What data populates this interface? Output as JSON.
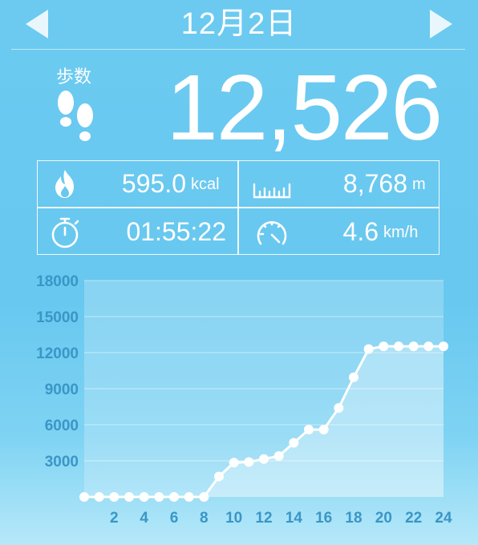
{
  "header": {
    "date": "12月2日",
    "prev_icon": "triangle-left",
    "next_icon": "triangle-right"
  },
  "steps": {
    "label": "歩数",
    "value": "12,526",
    "icon": "footprints"
  },
  "stats": {
    "calories": {
      "value": "595.0",
      "unit": "kcal",
      "icon": "flame"
    },
    "distance": {
      "value": "8,768",
      "unit": "m",
      "icon": "ruler"
    },
    "duration": {
      "value": "01:55:22",
      "unit": "",
      "icon": "stopwatch"
    },
    "speed": {
      "value": "4.6",
      "unit": "km/h",
      "icon": "speedometer"
    }
  },
  "colors": {
    "background": "#68c8ef",
    "tick_label": "#3a96c6",
    "line": "#ffffff"
  },
  "chart_data": {
    "type": "line",
    "x": [
      0,
      1,
      2,
      3,
      4,
      5,
      6,
      7,
      8,
      9,
      10,
      11,
      12,
      13,
      14,
      15,
      16,
      17,
      18,
      19,
      20,
      21,
      22,
      23,
      24
    ],
    "values": [
      0,
      0,
      0,
      0,
      0,
      0,
      0,
      0,
      0,
      1700,
      2850,
      2900,
      3150,
      3400,
      4500,
      5600,
      5600,
      7400,
      9950,
      12300,
      12526,
      12526,
      12526,
      12526,
      12526
    ],
    "y_ticks": [
      "3000",
      "6000",
      "9000",
      "12000",
      "15000",
      "18000"
    ],
    "x_ticks": [
      "2",
      "4",
      "6",
      "8",
      "10",
      "12",
      "14",
      "16",
      "18",
      "20",
      "22",
      "24"
    ],
    "ylim": [
      0,
      18000
    ],
    "xlim": [
      0,
      24
    ],
    "grid": true
  }
}
